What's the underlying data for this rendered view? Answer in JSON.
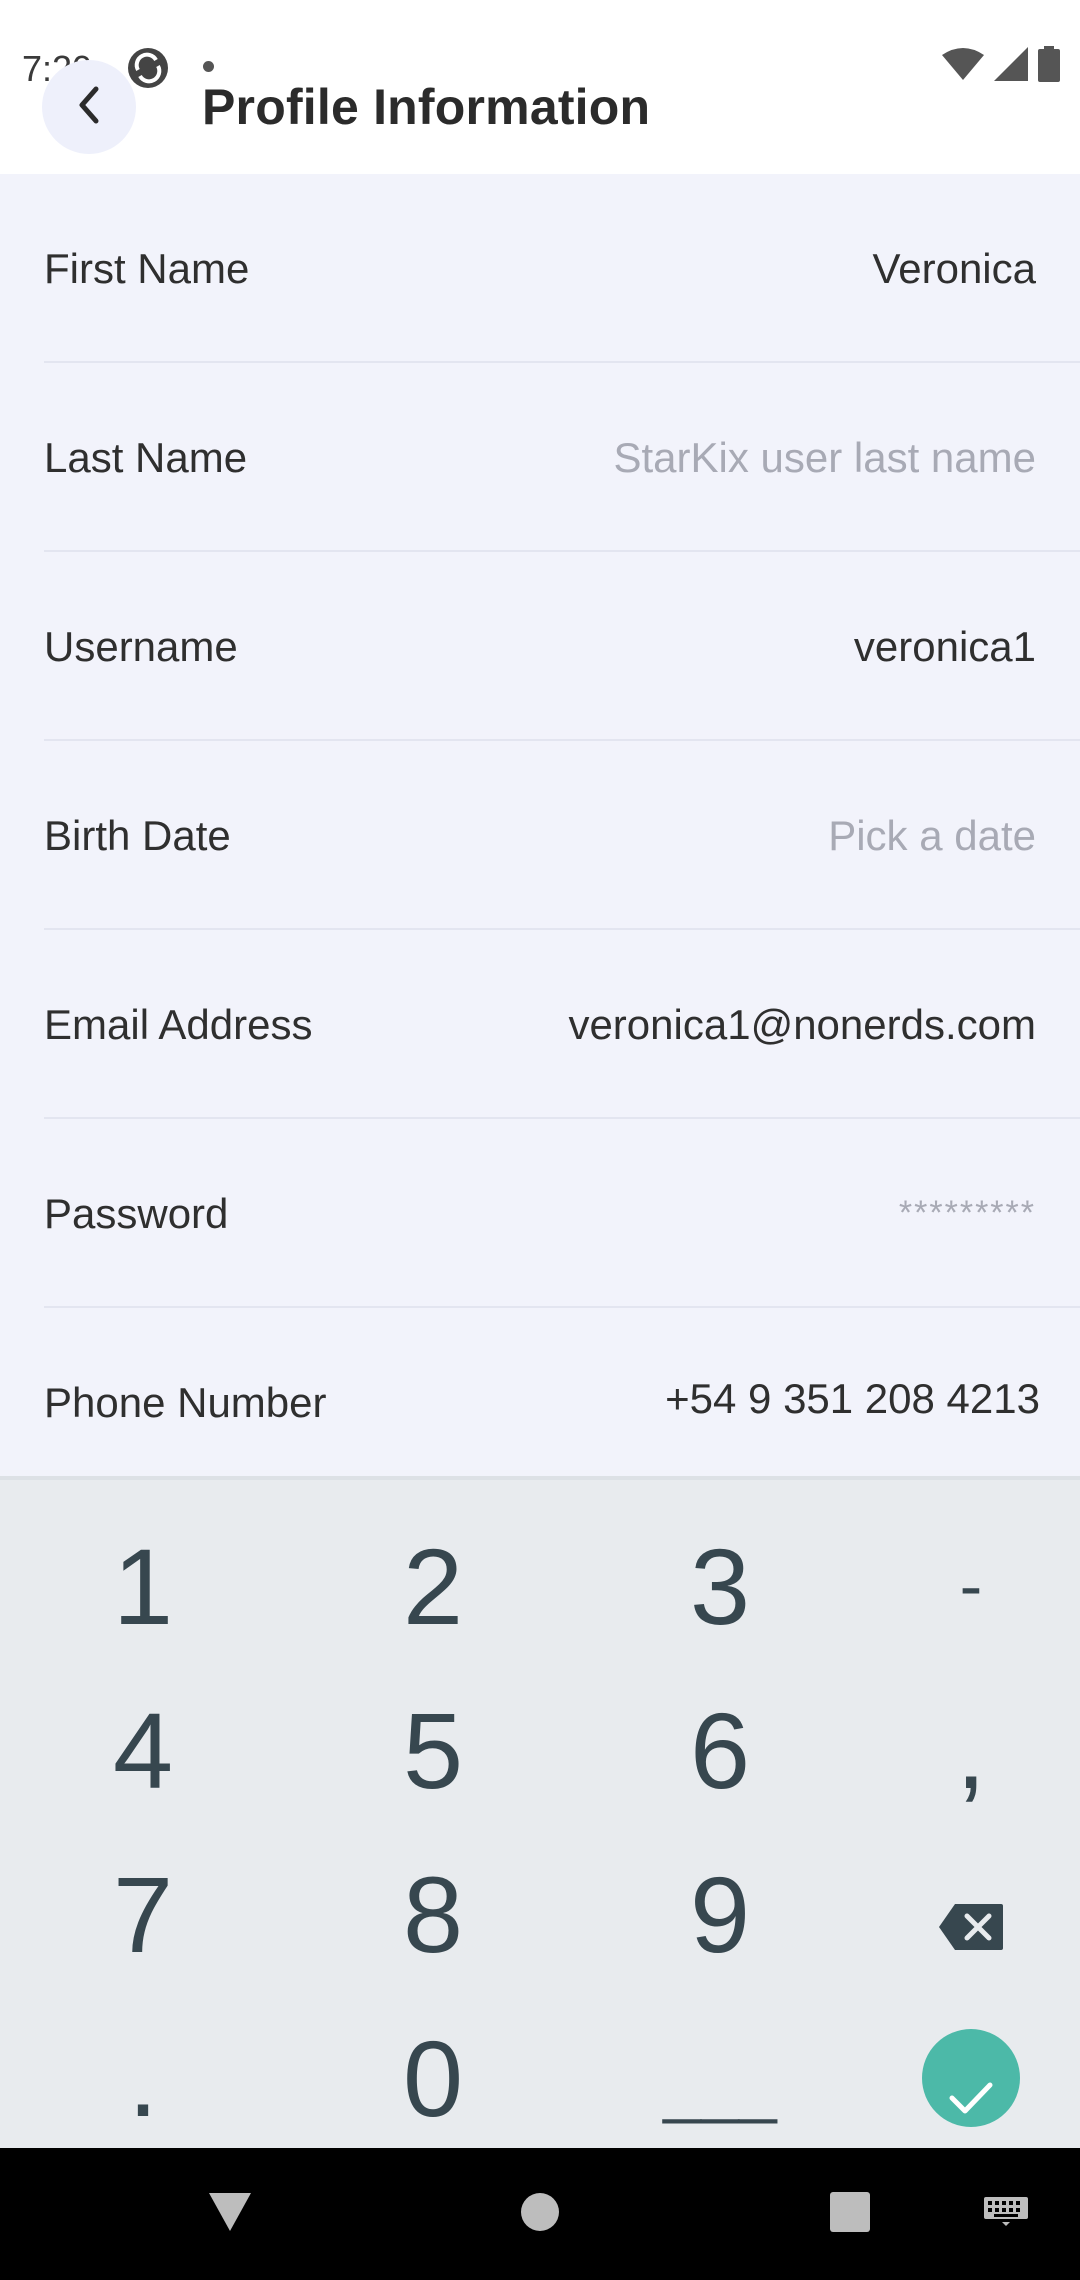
{
  "status": {
    "time": "7:20"
  },
  "header": {
    "title": "Profile Information"
  },
  "form": {
    "rows": [
      {
        "label": "First Name",
        "value": "Veronica"
      },
      {
        "label": "Last Name",
        "value": "StarKix user last name"
      },
      {
        "label": "Username",
        "value": "veronica1"
      },
      {
        "label": "Birth Date",
        "value": "Pick a date"
      },
      {
        "label": "Email Address",
        "value": "veronica1@nonerds.com"
      },
      {
        "label": "Password",
        "value": "*********"
      },
      {
        "label": "Phone Number",
        "value": "+54 9 351 208 4213"
      }
    ]
  },
  "keyboard": {
    "k1": "1",
    "k2": "2",
    "k3": "3",
    "dash": "-",
    "k4": "4",
    "k5": "5",
    "k6": "6",
    "comma": ",",
    "k7": "7",
    "k8": "8",
    "k9": "9",
    "dot": ".",
    "k0": "0",
    "space": "___"
  },
  "colors": {
    "accent": "#4cb9a8",
    "background": "#f2f3fb",
    "keyboard_bg": "#e8ebee"
  },
  "icons": [
    "back-arrow-icon",
    "wifi-icon",
    "signal-icon",
    "battery-icon",
    "backspace-icon",
    "checkmark-icon",
    "nav-back-icon",
    "nav-home-icon",
    "nav-recents-icon",
    "keyboard-icon"
  ]
}
